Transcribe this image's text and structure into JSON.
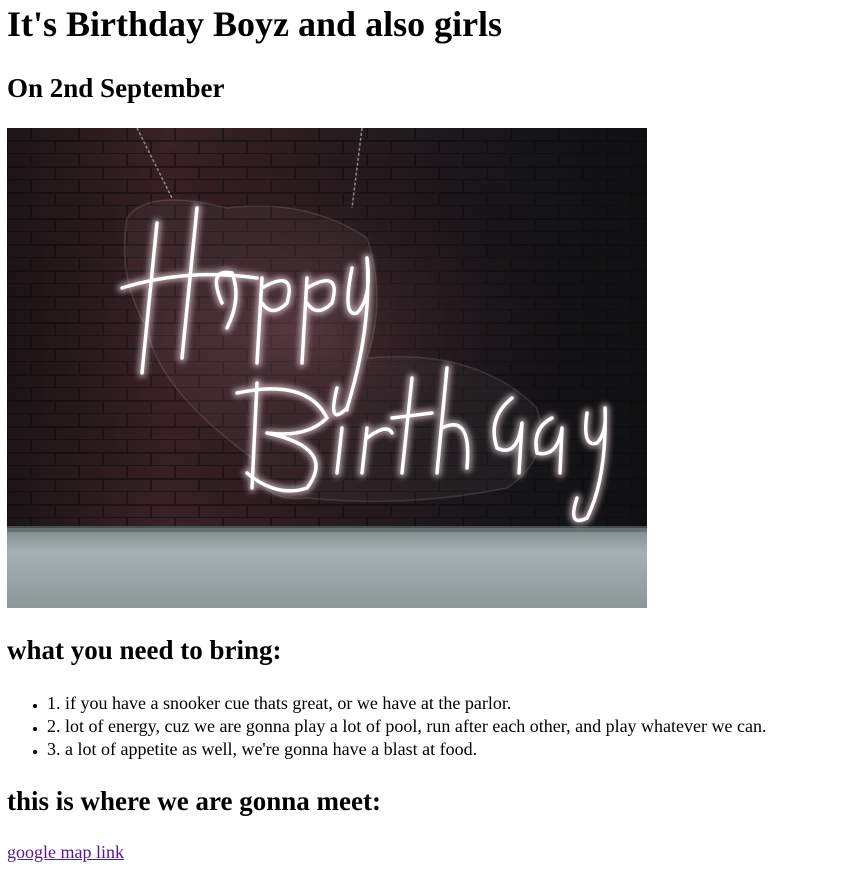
{
  "title": "It's Birthday Boyz and also girls",
  "date": "On 2nd September",
  "hero_image": {
    "text": "Happy Birthday"
  },
  "bring_heading": "what you need to bring:",
  "bring_items": [
    "1. if you have a snooker cue thats great, or we have at the parlor.",
    "2. lot of energy, cuz we are gonna play a lot of pool, run after each other, and play whatever we can.",
    "3. a lot of appetite as well, we're gonna have a blast at food."
  ],
  "meet_heading": "this is where we are gonna meet:",
  "map_link": "google map link",
  "colors": {
    "link_visited": "#551a8b",
    "neon": "#ffffff",
    "wall": "#2a1a1e",
    "floor": "#a9b4b6"
  }
}
